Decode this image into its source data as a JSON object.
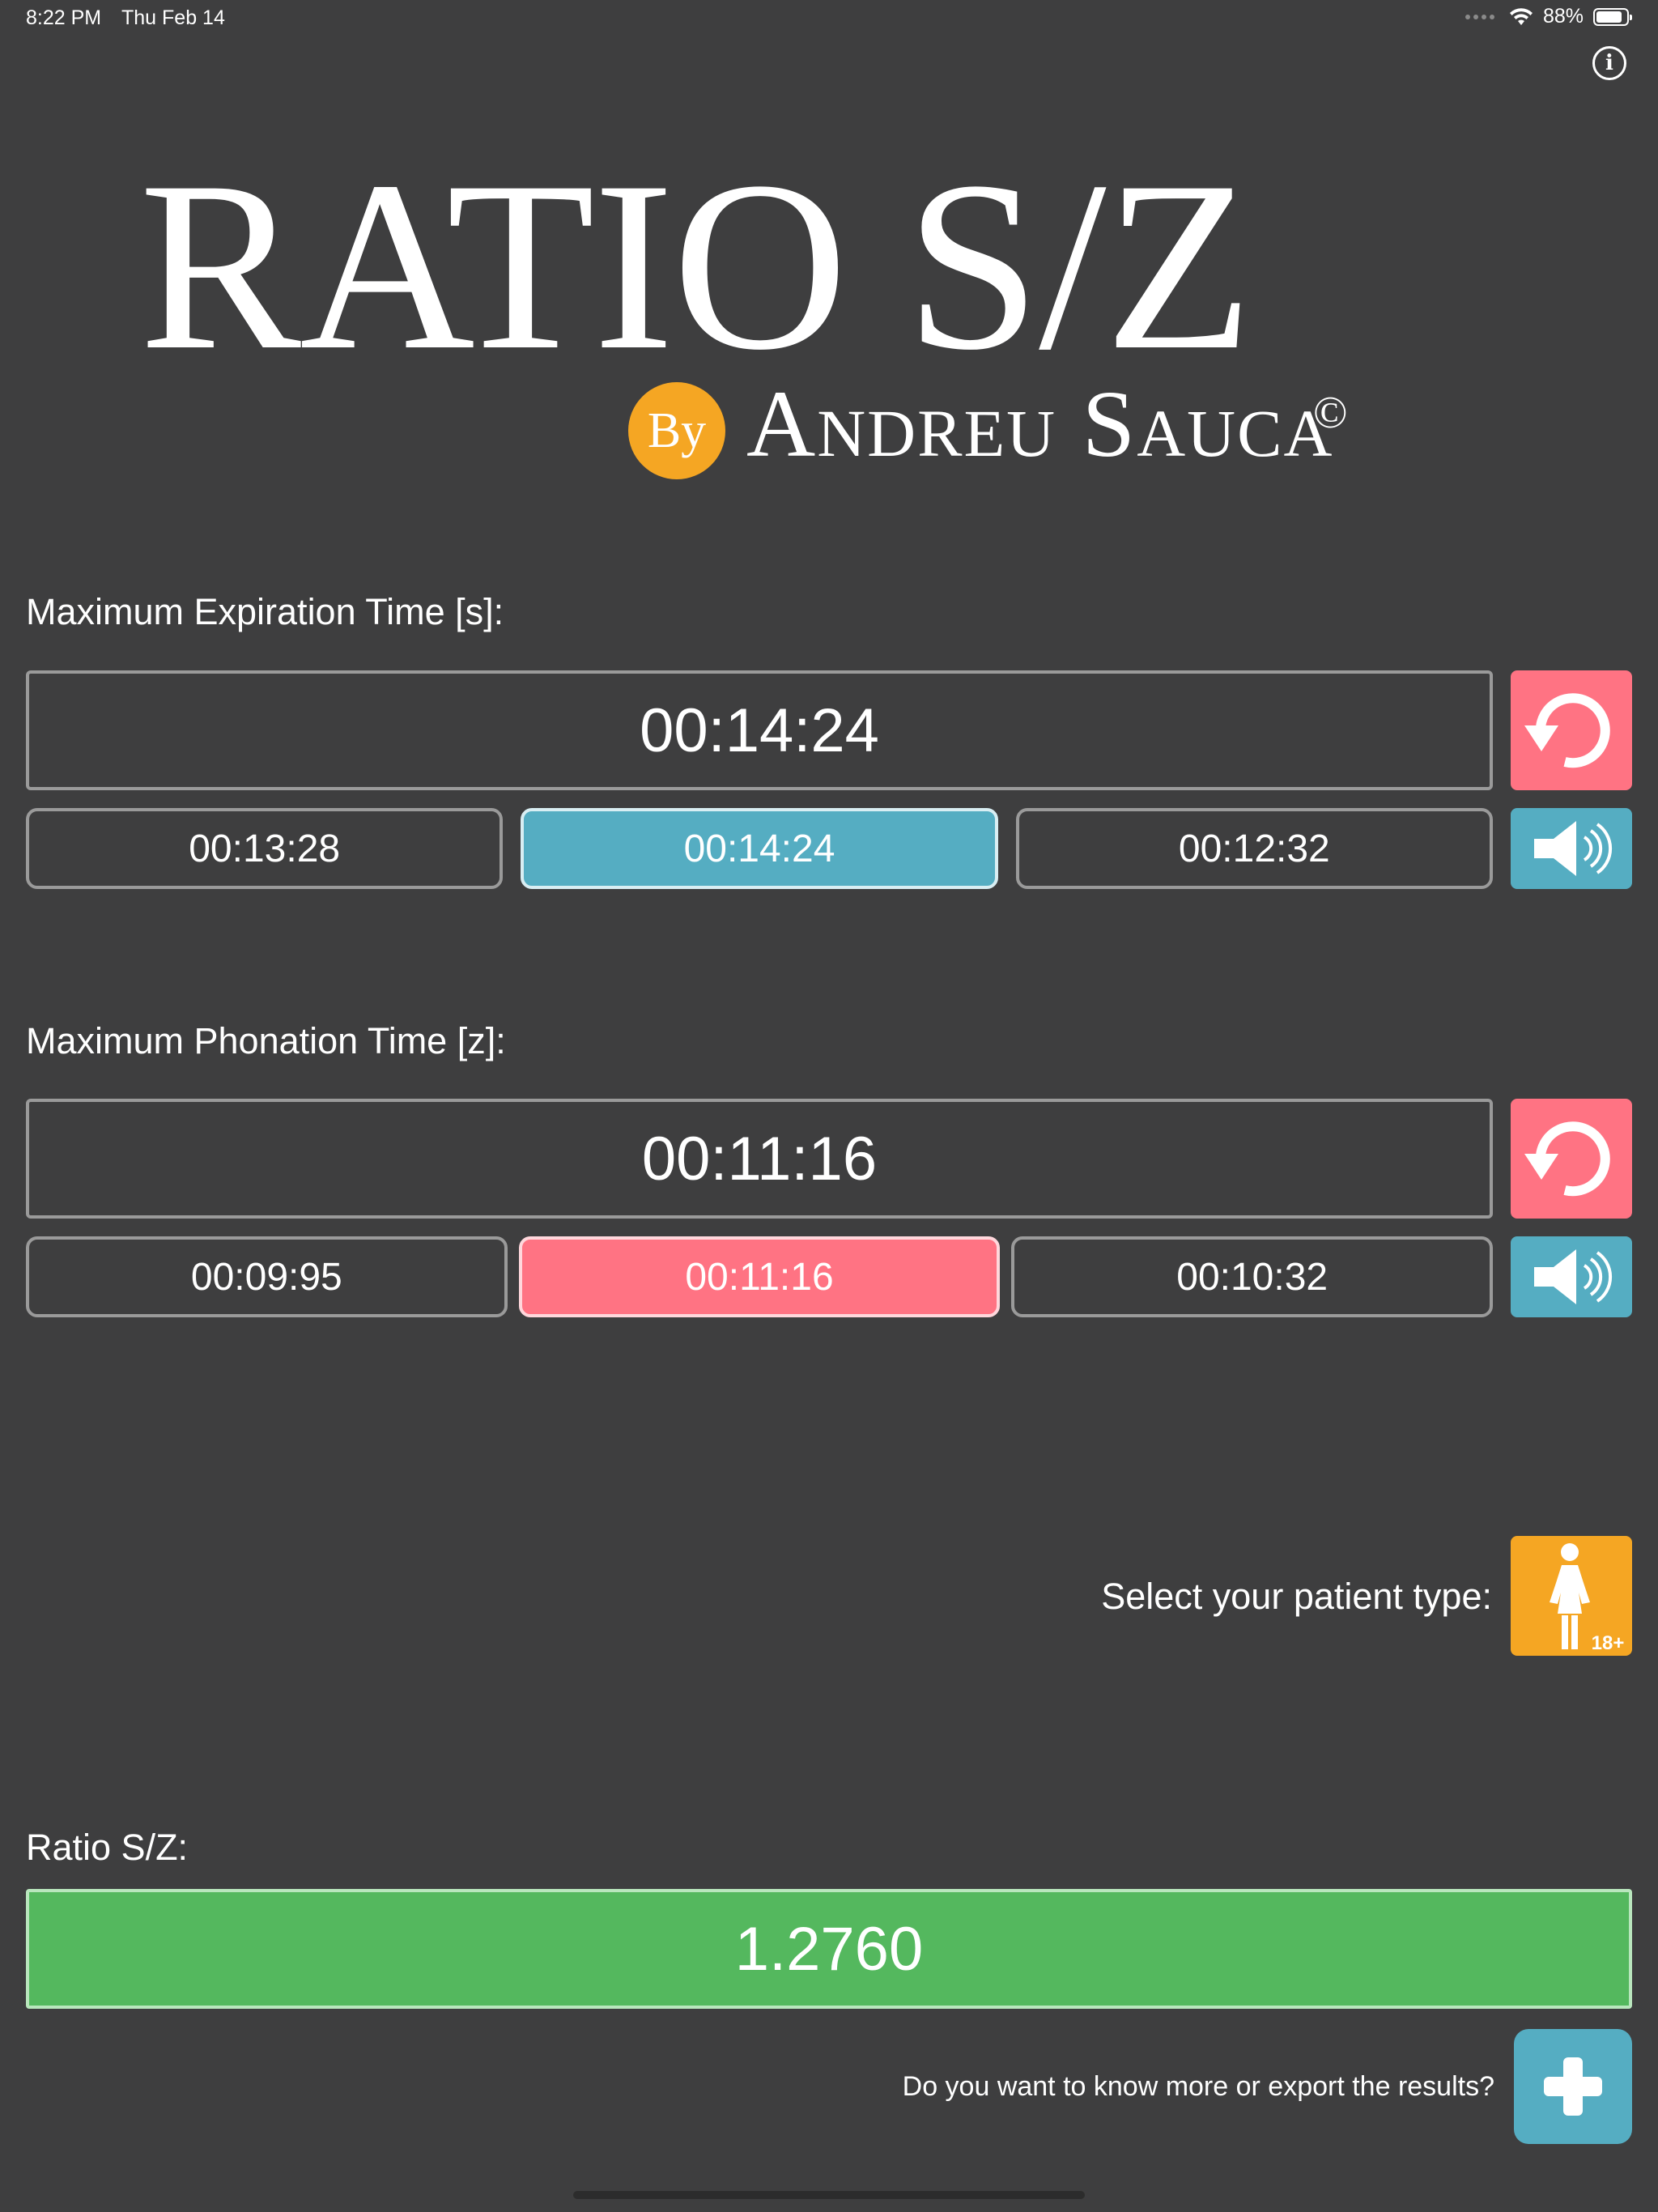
{
  "status_bar": {
    "time": "8:22 PM",
    "date": "Thu Feb 14",
    "battery": "88%",
    "battery_level": 0.88
  },
  "header": {
    "title": "RATIO S/Z",
    "by": "By",
    "author": "Andreu Sauca",
    "copyright": "©"
  },
  "expiration": {
    "label": "Maximum Expiration Time [s]:",
    "value": "00:14:24",
    "attempts": [
      "00:13:28",
      "00:14:24",
      "00:12:32"
    ],
    "selected_index": 1
  },
  "phonation": {
    "label": "Maximum Phonation Time [z]:",
    "value": "00:11:16",
    "attempts": [
      "00:09:95",
      "00:11:16",
      "00:10:32"
    ],
    "selected_index": 1
  },
  "patient": {
    "label": "Select your patient type:",
    "badge": "18+",
    "icon": "woman-icon"
  },
  "ratio": {
    "label": "Ratio S/Z:",
    "value": "1.2760"
  },
  "more": {
    "label": "Do you want to know more or export the results?",
    "icon": "plus-icon"
  },
  "colors": {
    "background": "#3e3e3f",
    "pink": "#ff7383",
    "blue": "#55adc2",
    "orange": "#f5a623",
    "green": "#54b85e"
  }
}
